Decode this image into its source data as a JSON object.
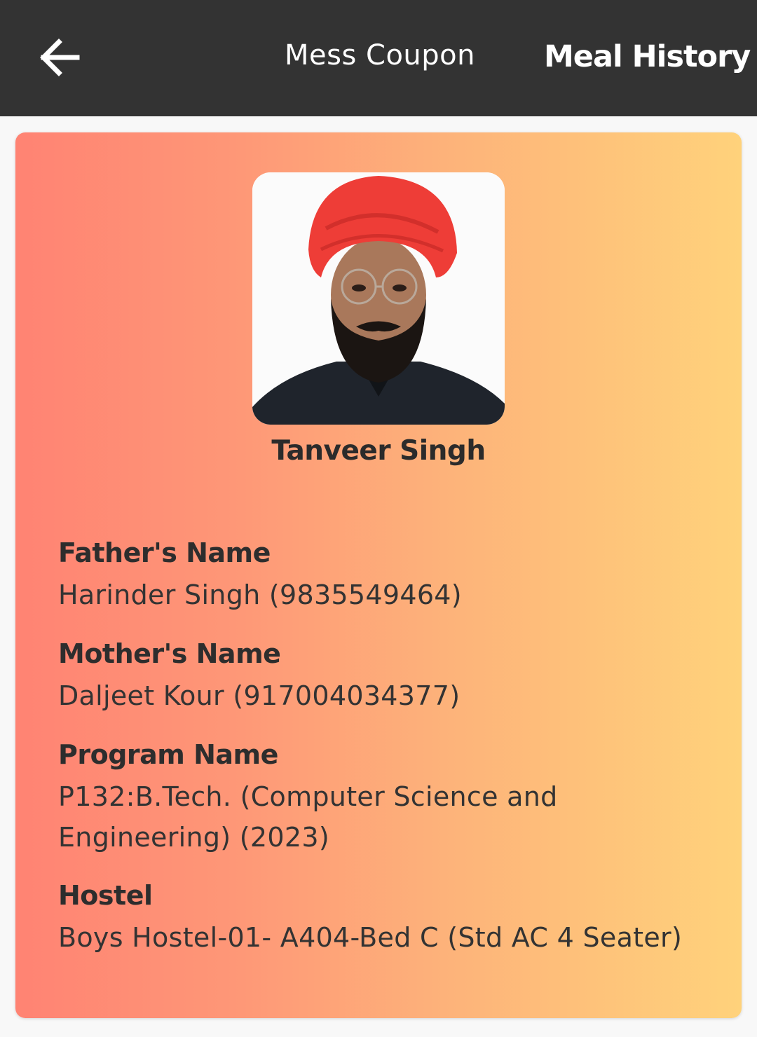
{
  "header": {
    "back_icon": "arrow-left-icon",
    "tabs": [
      {
        "label": "Mess Coupon",
        "active": false
      },
      {
        "label": "Meal History",
        "active": true
      }
    ],
    "background": "#333333"
  },
  "profile": {
    "name": "Tanveer Singh",
    "photo": "student-photo",
    "card_gradient": [
      "#ff8373",
      "#ffd27b"
    ]
  },
  "fields": [
    {
      "label": "Father's Name",
      "value": "Harinder Singh (9835549464)"
    },
    {
      "label": "Mother's Name",
      "value": "Daljeet Kour (917004034377)"
    },
    {
      "label": "Program Name",
      "value": "P132:B.Tech. (Computer Science and Engineering) (2023)"
    },
    {
      "label": "Hostel",
      "value": "Boys Hostel-01- A404-Bed C (Std AC 4 Seater)"
    }
  ]
}
